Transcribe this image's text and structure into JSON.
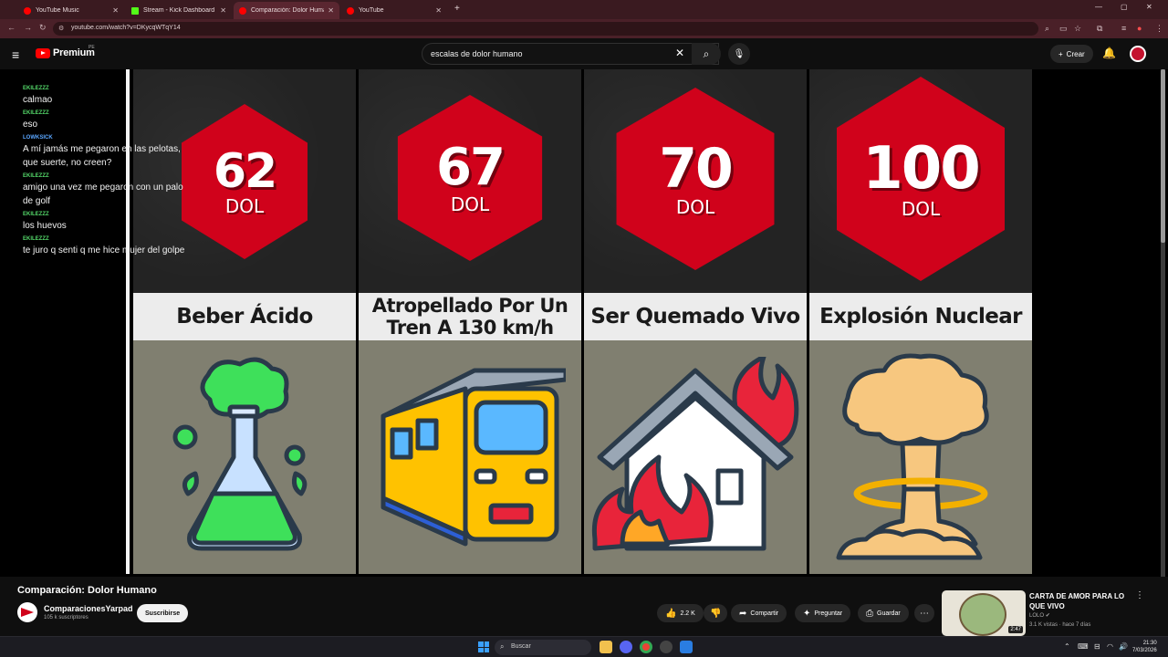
{
  "browser": {
    "tabs": [
      {
        "label": "YouTube Music",
        "active": false,
        "color": "#ff0000"
      },
      {
        "label": "Stream - Kick Dashboard",
        "active": false,
        "color": "#53fc18"
      },
      {
        "label": "Comparación: Dolor Humano",
        "active": true,
        "color": "#ff0000"
      },
      {
        "label": "YouTube",
        "active": false,
        "color": "#ff0000"
      }
    ],
    "url": "youtube.com/watch?v=DKycqWTqY14"
  },
  "youtube": {
    "logo_text": "Premium",
    "country_code": "PE",
    "search_value": "escalas de dolor humano",
    "create_label": "Crear"
  },
  "chat": [
    {
      "user": "EKILEZZZ",
      "message": "calmao",
      "user_color": "green"
    },
    {
      "user": "EKILEZZZ",
      "message": "eso",
      "user_color": "green"
    },
    {
      "user": "LOWKSICK",
      "message": "A mí jamás me pegaron en las pelotas, que suerte, no creen?",
      "user_color": "blue"
    },
    {
      "user": "EKILEZZZ",
      "message": "amigo una vez me pegaron con un palo de golf",
      "user_color": "green"
    },
    {
      "user": "EKILEZZZ",
      "message": "los huevos",
      "user_color": "green"
    },
    {
      "user": "EKILEZZZ",
      "message": "te juro q senti q me hice mujer del golpe",
      "user_color": "green"
    }
  ],
  "cards": [
    {
      "value": "62",
      "unit": "DOL",
      "label": "Beber Ácido",
      "icon": "acid-flask-icon"
    },
    {
      "value": "67",
      "unit": "DOL",
      "label": "Atropellado Por Un Tren A 130 km/h",
      "icon": "train-icon"
    },
    {
      "value": "70",
      "unit": "DOL",
      "label": "Ser Quemado Vivo",
      "icon": "burning-house-icon"
    },
    {
      "value": "100",
      "unit": "DOL",
      "label": "Explosión Nuclear",
      "icon": "mushroom-cloud-icon"
    }
  ],
  "video": {
    "title": "Comparación: Dolor Humano",
    "channel": "ComparacionesYarpad",
    "subscribers": "105 k suscriptores",
    "subscribe_label": "Suscribirse",
    "likes": "2.2 K",
    "share_label": "Compartir",
    "ask_label": "Preguntar",
    "save_label": "Guardar"
  },
  "recommendation": {
    "title": "CARTA DE AMOR PARA LO QUE VIVO",
    "channel": "LOLO",
    "meta": "3.1 K vistas · hace 7 días",
    "duration": "2:47"
  },
  "taskbar": {
    "search_placeholder": "Buscar",
    "time": "21:30",
    "date": "7/03/2026"
  },
  "colors": {
    "hex_red": "#d0021b",
    "card_dark": "#232323",
    "label_bg": "#ececec",
    "illus_bg": "#807f70"
  }
}
